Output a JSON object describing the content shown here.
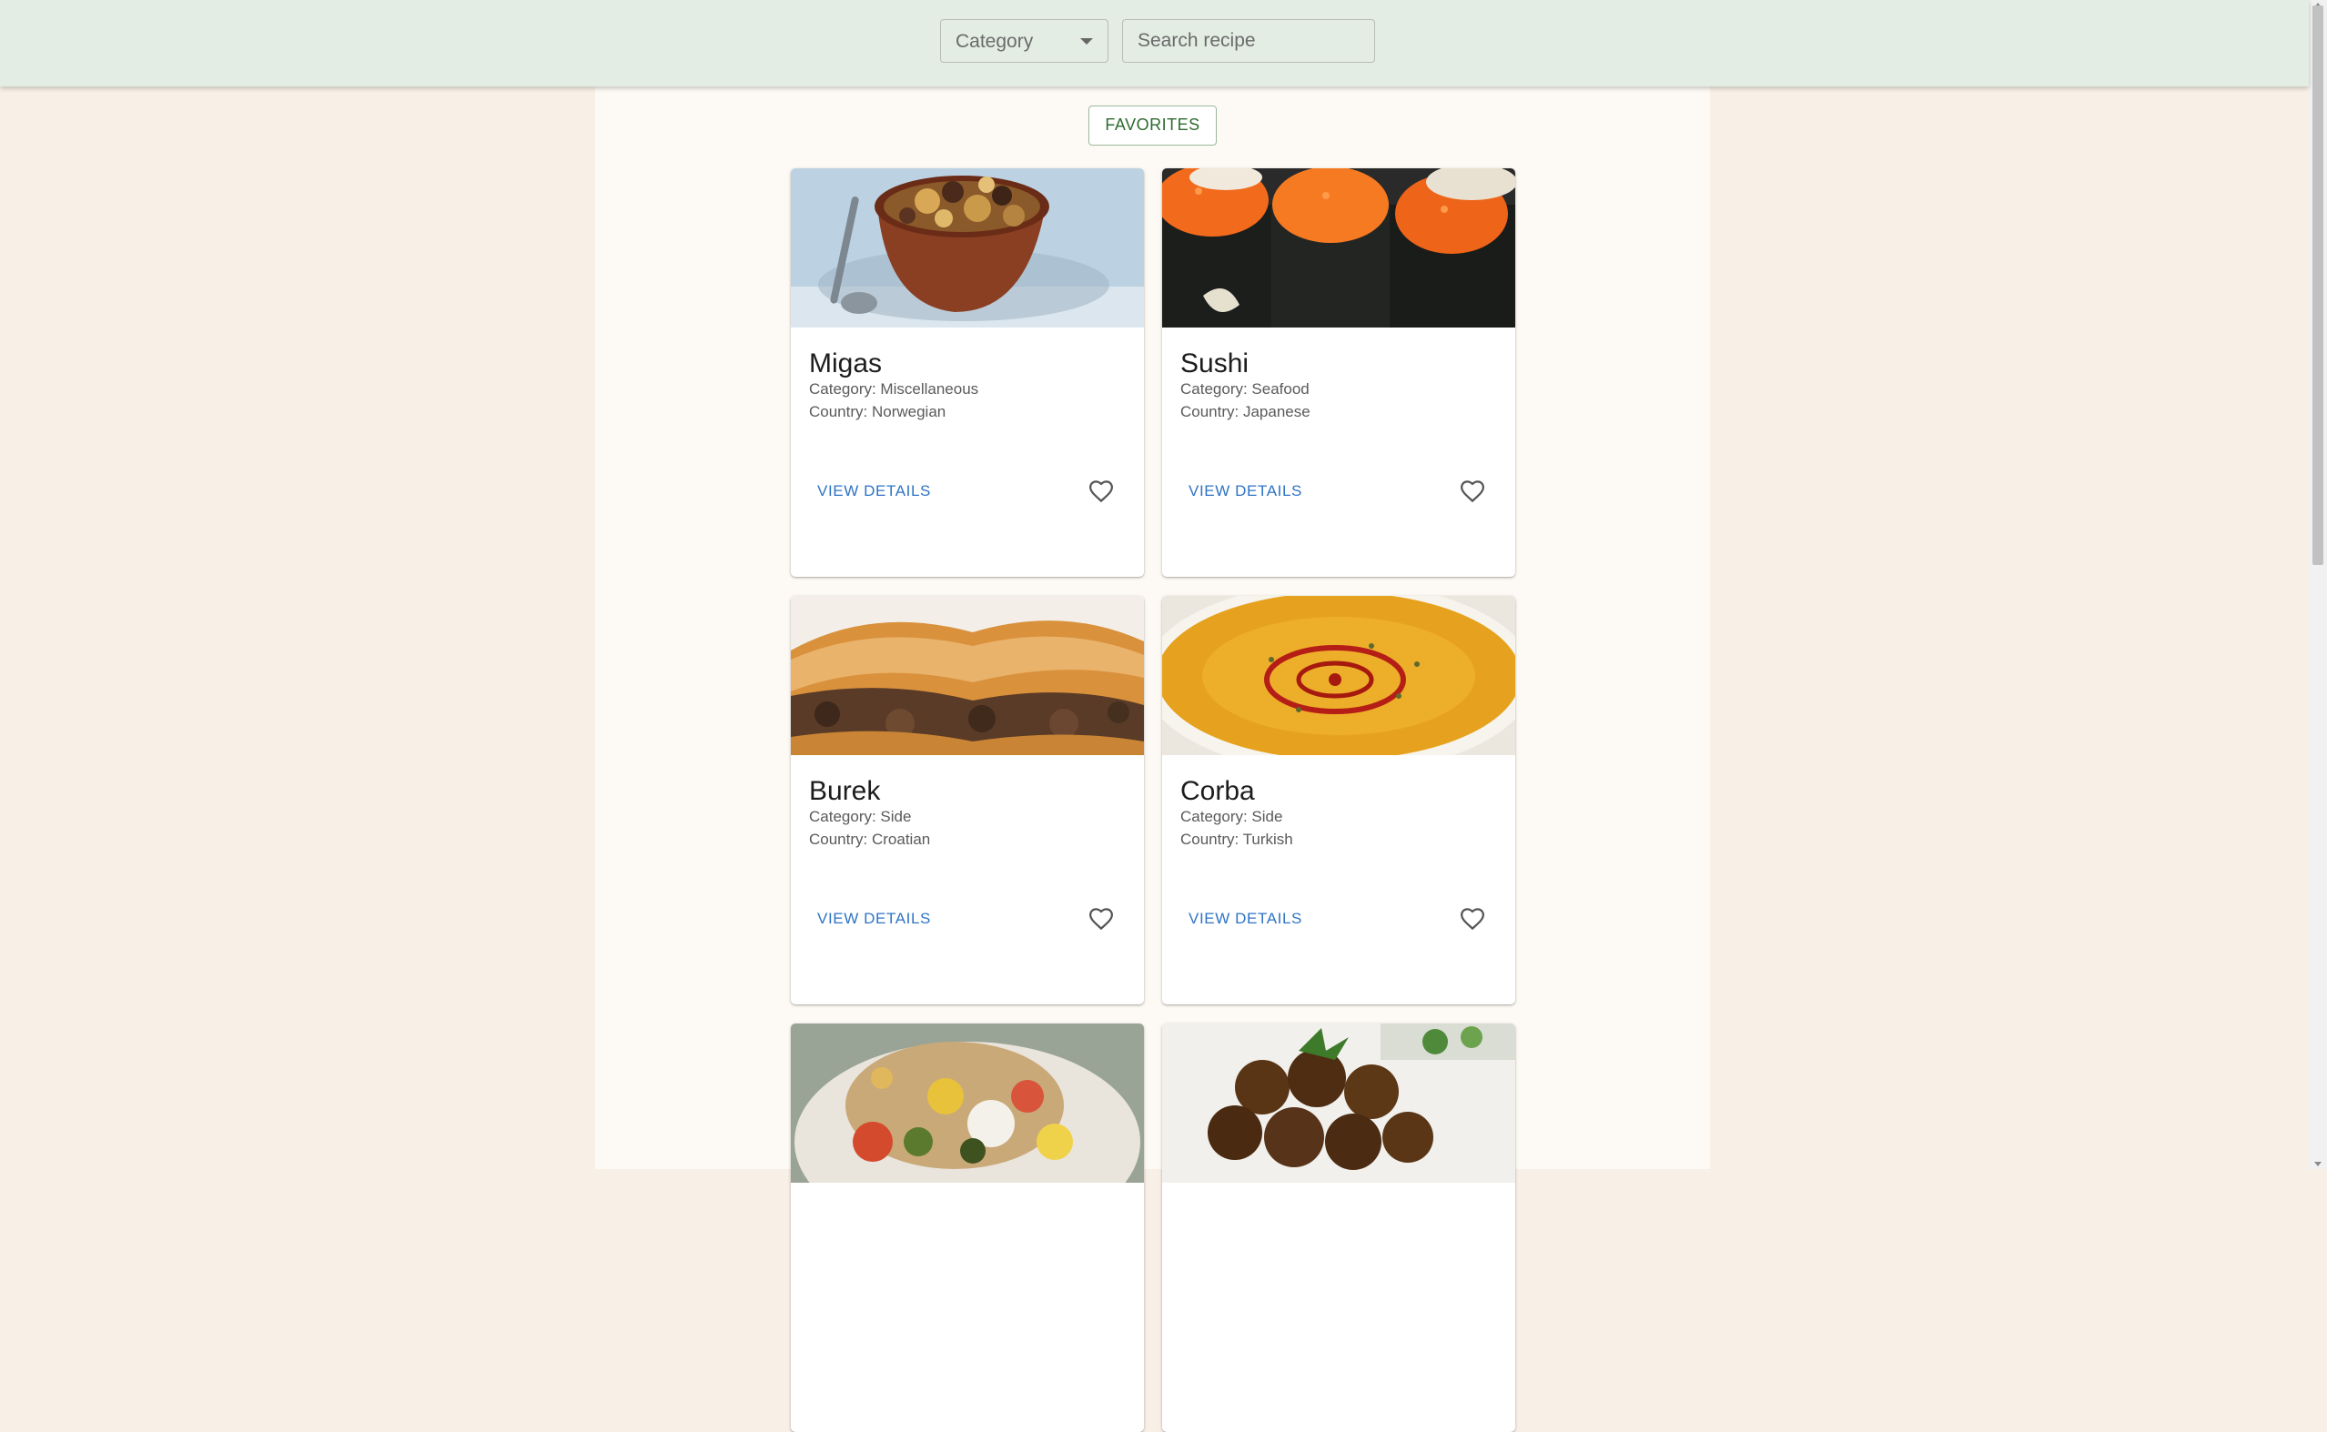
{
  "header": {
    "category_label": "Category",
    "search_placeholder": "Search recipe"
  },
  "favorites_label": "FAVORITES",
  "recipes": [
    {
      "name": "Migas",
      "category": "Category: Miscellaneous",
      "country": "Country: Norwegian",
      "action": "VIEW DETAILS"
    },
    {
      "name": "Sushi",
      "category": "Category: Seafood",
      "country": "Country: Japanese",
      "action": "VIEW DETAILS"
    },
    {
      "name": "Burek",
      "category": "Category: Side",
      "country": "Country: Croatian",
      "action": "VIEW DETAILS"
    },
    {
      "name": "Corba",
      "category": "Category: Side",
      "country": "Country: Turkish",
      "action": "VIEW DETAILS"
    }
  ],
  "colors": {
    "header_bg": "#e3ede4",
    "page_bg": "#f8f0e6",
    "link": "#2f73c5",
    "favorites_text": "#2e6b2f"
  },
  "icons": {
    "favorite": "heart-outline-icon",
    "dropdown": "caret-down-icon"
  }
}
